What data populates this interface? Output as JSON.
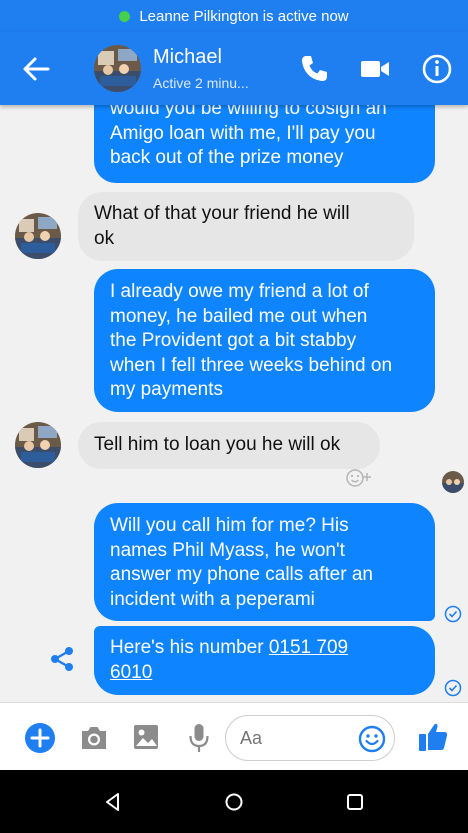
{
  "status_bar": {
    "text": "Leanne Pilkington is active now"
  },
  "header": {
    "name": "Michael",
    "status": "Active 2 minu..."
  },
  "messages": [
    {
      "dir": "out",
      "lines": [
        "would you be willing to cosign an",
        "Amigo loan with me, I'll pay you",
        "back out of the prize money"
      ]
    },
    {
      "dir": "in",
      "lines": [
        "What of that your friend he will",
        "ok"
      ]
    },
    {
      "dir": "out",
      "lines": [
        "I already owe my friend a lot of",
        "money, he bailed me out when",
        "the Provident got  a bit stabby",
        "when I fell three weeks behind on",
        "my payments"
      ]
    },
    {
      "dir": "in",
      "lines": [
        "Tell him to loan you he will ok"
      ]
    },
    {
      "dir": "out",
      "lines": [
        "Will you call him for me? His",
        "names Phil Myass, he won't",
        "answer my phone calls after an",
        "incident with a peperami"
      ]
    },
    {
      "dir": "out",
      "prefix": "Here's his number ",
      "link1": "0151 709",
      "link2": "6010"
    }
  ],
  "composer": {
    "placeholder": "Aa"
  },
  "colors": {
    "brand": "#1f7ef0",
    "outgoing": "#0e84ff",
    "incoming": "#e6e6e6",
    "active_dot": "#44d14d"
  }
}
